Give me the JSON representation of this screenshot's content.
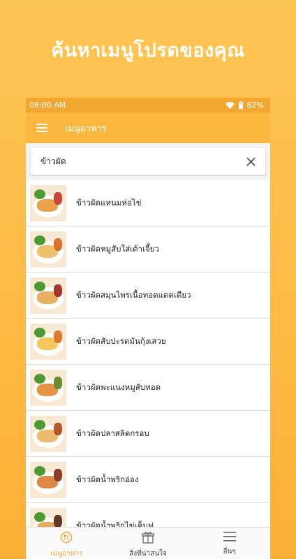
{
  "promo": {
    "headline": "ค้นหาเมนูโปรดของคุณ"
  },
  "status_bar": {
    "time": "08:00 AM",
    "battery": "82%"
  },
  "app_bar": {
    "title": "เมนูอาหาร"
  },
  "search": {
    "value": "ข้าวผัด"
  },
  "results": [
    {
      "label": "ข้าวผัดแหนมห่อไข่",
      "rice_color": "#e8a34a",
      "accent_color": "#c7473a"
    },
    {
      "label": "ข้าวผัดหมูสับใส่เต้าเจี้ยว",
      "rice_color": "#efc16c",
      "accent_color": "#d9722e"
    },
    {
      "label": "ข้าวผัดสมุนไพรเนื้อทอดแดดเดียว",
      "rice_color": "#e9b061",
      "accent_color": "#a2372f"
    },
    {
      "label": "ข้าวผัดสับปะรดมันกุ้งเสวย",
      "rice_color": "#f2c95a",
      "accent_color": "#e07a2c"
    },
    {
      "label": "ข้าวผัดพะแนงหมูสับทอด",
      "rice_color": "#e49443",
      "accent_color": "#6b8c2f"
    },
    {
      "label": "ข้าวผัดปลาสลิดกรอบ",
      "rice_color": "#edbb6e",
      "accent_color": "#b5562c"
    },
    {
      "label": "ข้าวผัดน้ำพริกอ่อง",
      "rice_color": "#dc8a46",
      "accent_color": "#8a3b2a"
    },
    {
      "label": "ข้าวผัดน้ำพริกไข่เค็มฟู",
      "rice_color": "#e7a860",
      "accent_color": "#5f3a2a"
    }
  ],
  "bottom_nav": [
    {
      "label": "เมนูอาหาร",
      "icon": "dish-icon",
      "active": true
    },
    {
      "label": "สิ่งที่น่าสนใจ",
      "icon": "gift-icon",
      "active": false
    },
    {
      "label": "อื่นๆ",
      "icon": "hamburger-icon",
      "active": false
    }
  ],
  "colors": {
    "accent": "#f2a733",
    "app_bar": "#fbb73f"
  }
}
